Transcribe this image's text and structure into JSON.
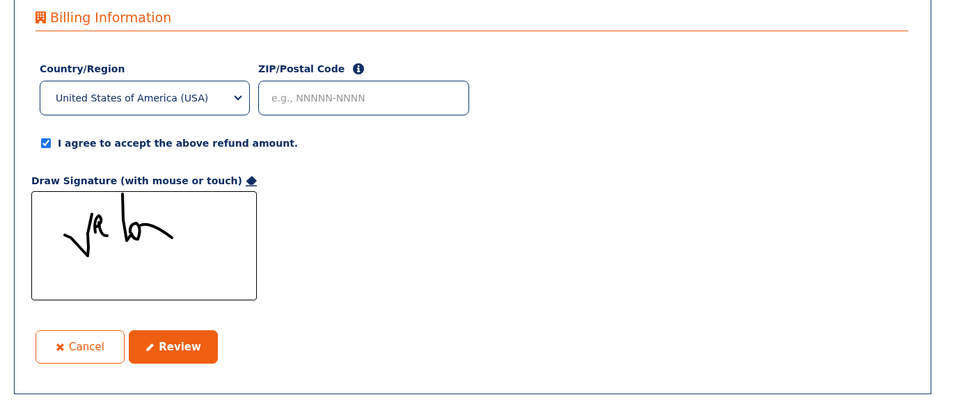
{
  "section": {
    "title": "Billing Information"
  },
  "fields": [
    {
      "kind": "select",
      "label": "Country/Region",
      "value": "United States of America (USA)"
    },
    {
      "kind": "text",
      "label": "ZIP/Postal Code",
      "placeholder": "e.g., NNNNN-NNNN",
      "info": true
    }
  ],
  "agreement": {
    "label": "I agree to accept the above refund amount.",
    "checked": true
  },
  "signature": {
    "label": "Draw Signature (with mouse or touch)"
  },
  "buttons": [
    {
      "kind": "cancel",
      "label": "Cancel"
    },
    {
      "kind": "review",
      "label": "Review"
    }
  ]
}
